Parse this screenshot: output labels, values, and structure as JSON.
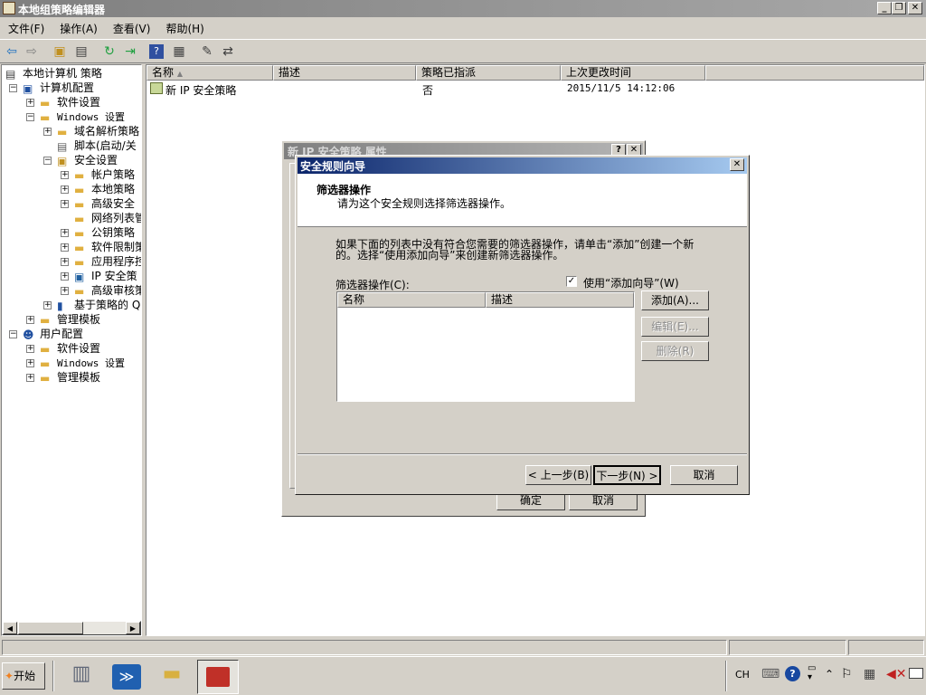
{
  "window": {
    "title": "本地组策略编辑器",
    "minimize": "_",
    "restore": "❐",
    "close": "✕"
  },
  "menu": [
    "文件(F)",
    "操作(A)",
    "查看(V)",
    "帮助(H)"
  ],
  "toolbar": {
    "icons": [
      "back-icon",
      "forward-icon",
      "up-folder-icon",
      "show-hide-tree-icon",
      "refresh-icon",
      "export-list-icon",
      "help-icon",
      "properties-icon",
      "new-policy-icon",
      "assign-icon"
    ]
  },
  "tree": {
    "root": "本地计算机 策略",
    "computer": "计算机配置",
    "software": "软件设置",
    "windows": "Windows 设置",
    "dns": "域名解析策略",
    "scripts": "脚本(启动/关",
    "security": "安全设置",
    "account": "帐户策略",
    "local": "本地策略",
    "advfw": "高级安全",
    "netlist": "网络列表管",
    "pubkey": "公钥策略",
    "swrestrict": "软件限制策",
    "applocker": "应用程序控",
    "ipsec": "IP 安全策",
    "advaudit": "高级审核策",
    "qos": "基于策略的 Q",
    "admintpl": "管理模板",
    "user": "用户配置",
    "u_software": "软件设置",
    "u_windows": "Windows 设置",
    "u_admintpl": "管理模板"
  },
  "list": {
    "columns": [
      "名称",
      "描述",
      "策略已指派",
      "上次更改时间"
    ],
    "rows": [
      {
        "name": "新 IP 安全策略",
        "desc": "",
        "assigned": "否",
        "modified": "2015/11/5 14:12:06"
      }
    ]
  },
  "props_dialog": {
    "title": "新 IP 安全策略 属性",
    "help": "?",
    "close": "✕",
    "ok": "确定",
    "cancel": "取消"
  },
  "wizard": {
    "title": "安全规则向导",
    "close": "✕",
    "heading": "筛选器操作",
    "subheading": "请为这个安全规则选择筛选器操作。",
    "desc1": "如果下面的列表中没有符合您需要的筛选器操作，请单击“添加”创建一个新",
    "desc2": "的。选择“使用添加向导”来创建新筛选器操作。",
    "filter_label": "筛选器操作(C):",
    "use_wizard": "使用“添加向导”(W)",
    "use_wizard_checked": true,
    "table_cols": [
      "名称",
      "描述"
    ],
    "add": "添加(A)...",
    "edit": "编辑(E)...",
    "remove": "删除(R)",
    "back": "< 上一步(B)",
    "next": "下一步(N) >",
    "cancel": "取消"
  },
  "taskbar": {
    "start": "开始",
    "lang": "CH",
    "time_icon": "clock-icon"
  }
}
